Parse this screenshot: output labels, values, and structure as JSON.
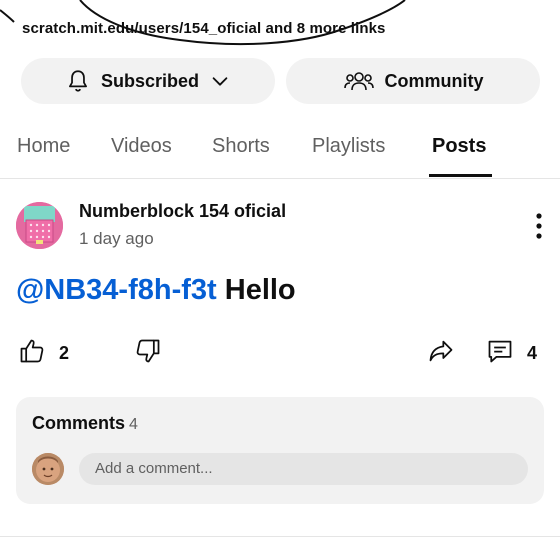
{
  "links": {
    "text": "scratch.mit.edu/users/154_oficial and 8 more links"
  },
  "buttons": {
    "subscribed_label": "Subscribed",
    "community_label": "Community"
  },
  "tabs": [
    {
      "label": "Home"
    },
    {
      "label": "Videos"
    },
    {
      "label": "Shorts"
    },
    {
      "label": "Playlists"
    },
    {
      "label": "Posts",
      "active": true
    }
  ],
  "post": {
    "channel_name": "Numberblock 154 oficial",
    "time": "1 day ago",
    "mention": "@NB34-f8h-f3t",
    "text": "Hello",
    "like_count": "2",
    "comment_count": "4"
  },
  "comments": {
    "title": "Comments",
    "count": "4",
    "placeholder": "Add a comment..."
  },
  "colors": {
    "mention": "#065fd4",
    "pill_bg": "#f2f2f2",
    "secondary_text": "#606060"
  },
  "icons": [
    "bell-icon",
    "chevron-down-icon",
    "community-icon",
    "more-vert-icon",
    "thumb-up-icon",
    "thumb-down-icon",
    "share-icon",
    "comment-icon"
  ]
}
